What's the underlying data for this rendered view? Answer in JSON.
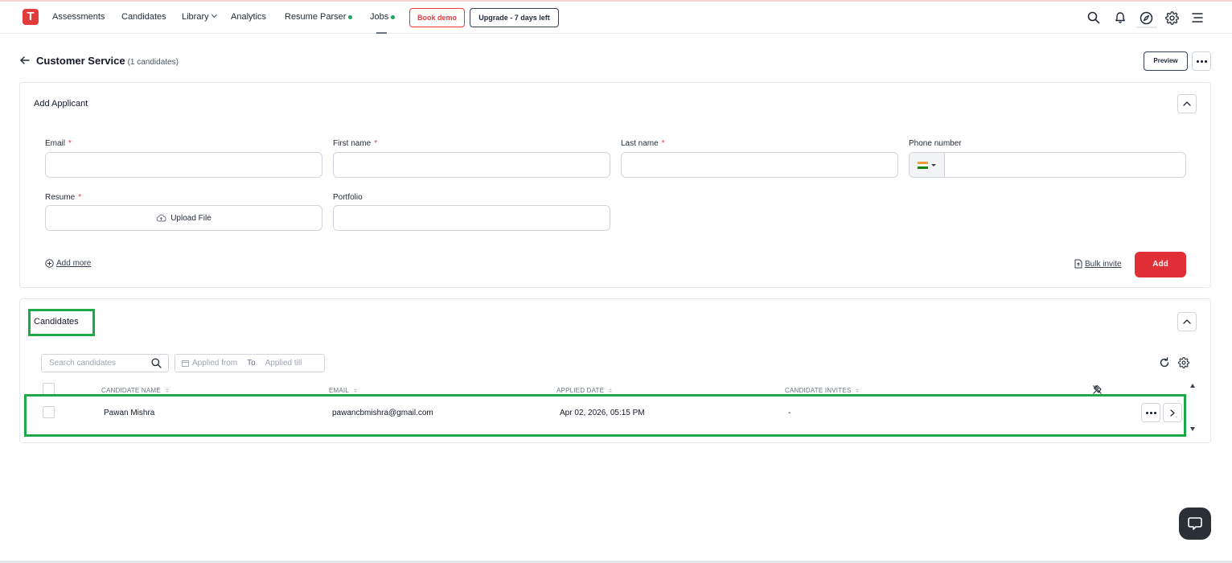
{
  "nav": {
    "logo_letter": "T",
    "items": [
      {
        "label": "Assessments"
      },
      {
        "label": "Candidates"
      },
      {
        "label": "Library"
      },
      {
        "label": "Analytics"
      },
      {
        "label": "Resume Parser"
      },
      {
        "label": "Jobs"
      }
    ],
    "book_demo": "Book demo",
    "upgrade": "Upgrade - 7 days left",
    "icons": [
      "search-icon",
      "bell-icon",
      "compass-icon",
      "gear-icon",
      "menu-icon"
    ]
  },
  "page": {
    "title": "Customer Service",
    "count": "(1 candidates)",
    "preview": "Preview"
  },
  "add_applicant": {
    "title": "Add Applicant",
    "fields": {
      "email": {
        "label": "Email",
        "required_mark": "*",
        "value": ""
      },
      "first_name": {
        "label": "First name",
        "required_mark": "*",
        "value": ""
      },
      "last_name": {
        "label": "Last name",
        "required_mark": "*",
        "value": ""
      },
      "phone": {
        "label": "Phone number",
        "value": "",
        "country_flag": "india-flag"
      },
      "resume": {
        "label": "Resume",
        "required_mark": "*",
        "upload_label": "Upload File"
      },
      "portfolio": {
        "label": "Portfolio",
        "value": ""
      }
    },
    "add_more": "Add more",
    "bulk_invite": "Bulk invite",
    "add_button": "Add"
  },
  "candidates": {
    "title": "Candidates",
    "search_placeholder": "Search candidates",
    "applied_from": "Applied from",
    "to": "To",
    "applied_till": "Applied till",
    "columns": [
      "CANDIDATE NAME",
      "EMAIL",
      "APPLIED DATE",
      "CANDIDATE INVITES"
    ],
    "rows": [
      {
        "name": "Pawan Mishra",
        "email": "pawancbmishra@gmail.com",
        "applied_date": "Apr 02, 2026, 05:15 PM",
        "invites": "-"
      }
    ]
  },
  "colors": {
    "brand_red": "#e02f36",
    "highlight_green": "#1fa84a",
    "status_dot": "#22a560"
  }
}
